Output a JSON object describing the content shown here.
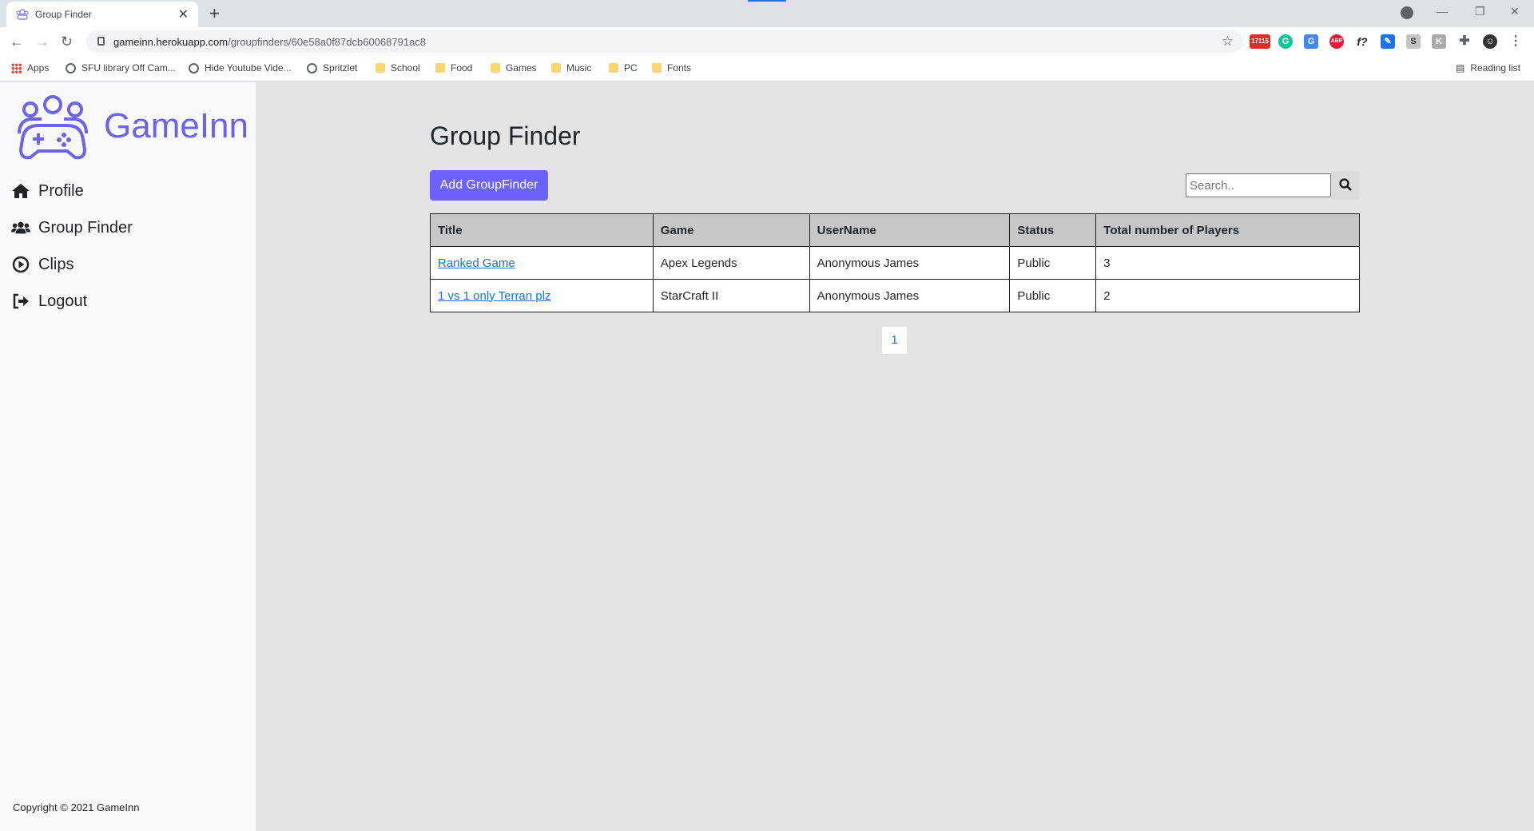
{
  "browser": {
    "tab_title": "Group Finder",
    "tab_close": "✕",
    "new_tab": "+",
    "url_host": "gameinn.herokuapp.com",
    "url_path": "/groupfinders/60e58a0f87dcb60068791ac8",
    "extension_badge": "17115",
    "reading_list": "Reading list",
    "bookmarks": [
      "Apps",
      "SFU library Off Cam...",
      "Hide Youtube Vide...",
      "Spritzlet",
      "School",
      "Food",
      "Games",
      "Music",
      "PC",
      "Fonts"
    ]
  },
  "sidebar": {
    "brand": "GameInn",
    "nav": [
      {
        "label": "Profile",
        "icon": "home-icon"
      },
      {
        "label": "Group Finder",
        "icon": "users-icon"
      },
      {
        "label": "Clips",
        "icon": "play-circle-icon"
      },
      {
        "label": "Logout",
        "icon": "sign-out-icon"
      }
    ],
    "copyright": "Copyright © 2021 GameInn"
  },
  "main": {
    "title": "Group Finder",
    "add_button": "Add GroupFinder",
    "search_placeholder": "Search..",
    "table": {
      "headers": [
        "Title",
        "Game",
        "UserName",
        "Status",
        "Total number of Players"
      ],
      "rows": [
        [
          "Ranked Game",
          "Apex Legends",
          "Anonymous James",
          "Public",
          "3"
        ],
        [
          "1 vs 1 only Terran plz",
          "StarCraft II",
          "Anonymous James",
          "Public",
          "2"
        ]
      ]
    },
    "pagination": [
      "1"
    ]
  },
  "colors": {
    "accent": "#6c63ff",
    "brand": "#6c63e6",
    "link": "#1a6fd8"
  }
}
